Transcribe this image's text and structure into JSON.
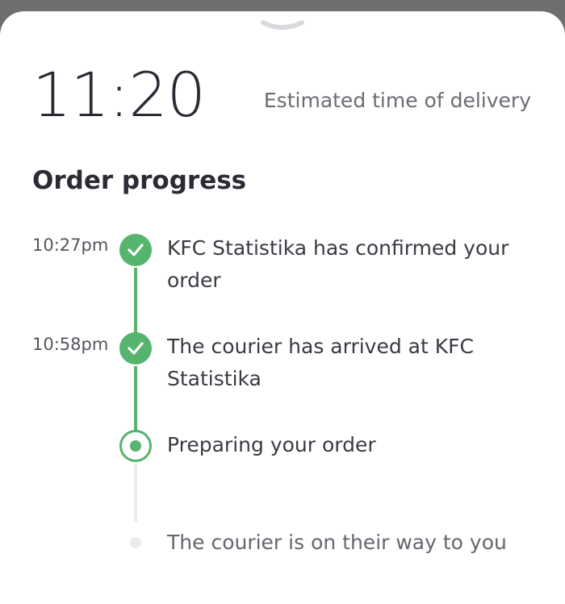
{
  "eta": {
    "time": "11:20",
    "label": "Estimated time of delivery"
  },
  "order_progress": {
    "title": "Order progress",
    "steps": [
      {
        "time": "10:27pm",
        "text": "KFC Statistika has confirmed your order",
        "status": "done"
      },
      {
        "time": "10:58pm",
        "text": "The courier has arrived at KFC Statistika",
        "status": "done"
      },
      {
        "time": "",
        "text": "Preparing your order",
        "status": "current"
      },
      {
        "time": "",
        "text": "The courier is on their way to you",
        "status": "pending"
      }
    ]
  },
  "icons": {
    "handle": "chevron-down-icon",
    "done": "check-circle-icon",
    "current": "radio-dot-icon",
    "pending": "dot-icon"
  },
  "colors": {
    "accent_green": "#55b46e",
    "pending_gray": "#ececec",
    "text_dark": "#2b2b36",
    "text_muted": "#6c6c74"
  }
}
